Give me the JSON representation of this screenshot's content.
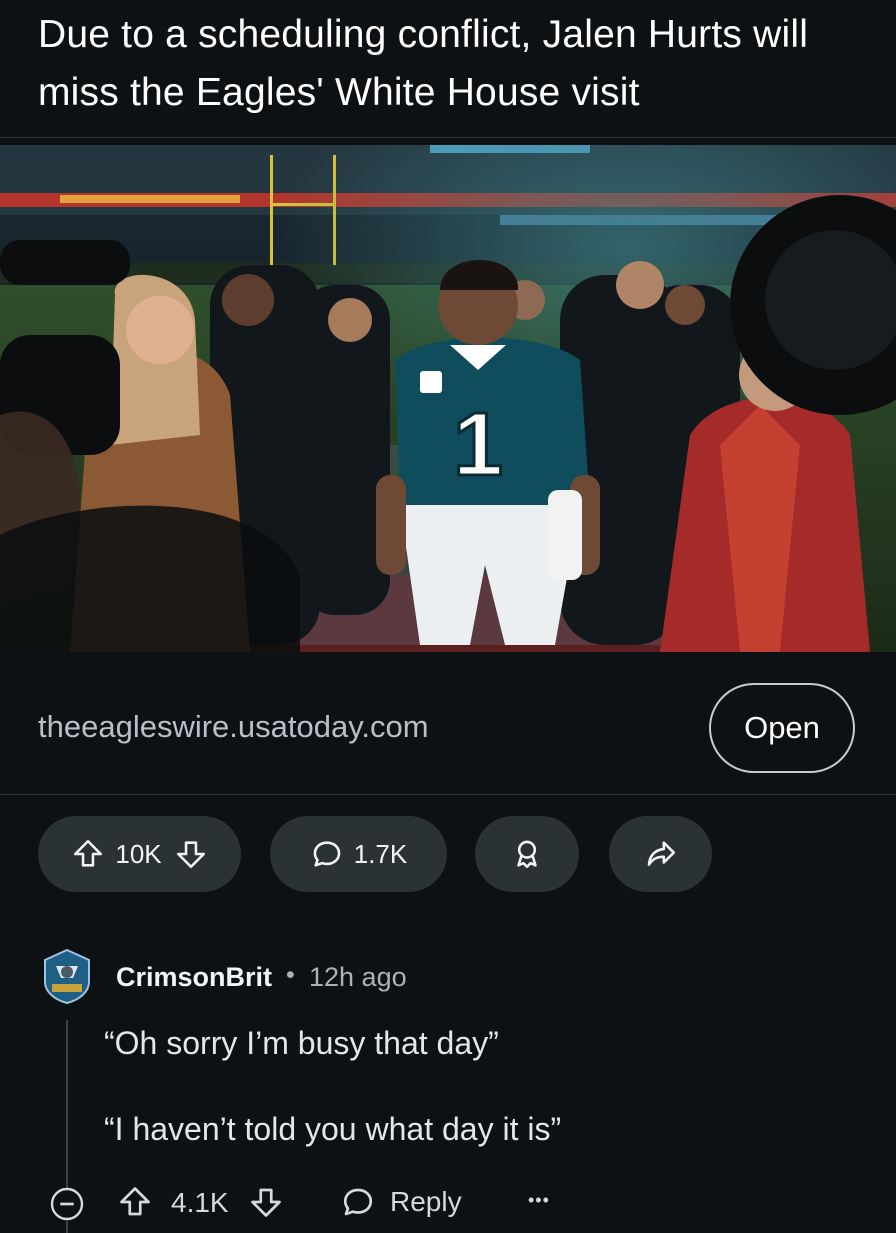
{
  "post": {
    "title": "Due to a scheduling conflict, Jalen Hurts will miss the Eagles' White House visit",
    "image_alt_icon": "photo-of-player-on-field",
    "jersey_number": "1",
    "link_domain": "theeagleswire.usatoday.com",
    "open_label": "Open",
    "vote_count": "10K",
    "comment_count": "1.7K"
  },
  "comment": {
    "author": "CrimsonBrit",
    "separator": "•",
    "time": "12h ago",
    "line1": "“Oh sorry I’m busy that day”",
    "line2": "“I haven’t told you what day it is”",
    "vote_count": "4.1K",
    "reply_label": "Reply",
    "more_label": "•••"
  },
  "colors": {
    "background": "#0e1113",
    "pill": "#2a3236",
    "muted_text": "#a8b3b8",
    "jersey_green": "#0f4c5c"
  }
}
